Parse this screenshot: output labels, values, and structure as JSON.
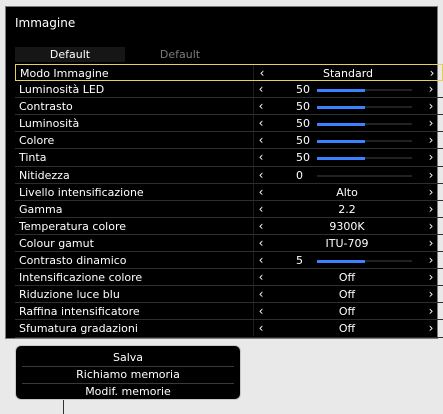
{
  "window": {
    "title": "Immagine"
  },
  "tabs": [
    {
      "label": "Default",
      "active": true
    },
    {
      "label": "Default",
      "active": false
    }
  ],
  "settings": [
    {
      "label": "Modo Immagine",
      "value": "Standard",
      "selected": true
    },
    {
      "label": "Luminosità LED",
      "value": "50",
      "slider": 0.5
    },
    {
      "label": "Contrasto",
      "value": "50",
      "slider": 0.5
    },
    {
      "label": "Luminosità",
      "value": "50",
      "slider": 0.5
    },
    {
      "label": "Colore",
      "value": "50",
      "slider": 0.5
    },
    {
      "label": "Tinta",
      "value": "50",
      "slider": 0.5
    },
    {
      "label": "Nitidezza",
      "value": "0",
      "slider": 0.0
    },
    {
      "label": "Livello intensificazione",
      "value": "Alto"
    },
    {
      "label": "Gamma",
      "value": "2.2"
    },
    {
      "label": "Temperatura colore",
      "value": "9300K"
    },
    {
      "label": "Colour gamut",
      "value": "ITU-709"
    },
    {
      "label": "Contrasto dinamico",
      "value": "5",
      "slider": 0.5
    },
    {
      "label": "Intensificazione colore",
      "value": "Off"
    },
    {
      "label": "Riduzione luce blu",
      "value": "Off"
    },
    {
      "label": "Raffina intensificatore",
      "value": "Off"
    },
    {
      "label": "Sfumatura gradazioni",
      "value": "Off"
    }
  ],
  "arrows": {
    "left": "‹",
    "right": "›"
  },
  "colors": {
    "slider_fill": "#3b82ff",
    "selection_border": "#e2d25b"
  },
  "menu": {
    "items": [
      {
        "label": "Salva"
      },
      {
        "label": "Richiamo memoria"
      },
      {
        "label": "Modif. memorie"
      }
    ]
  }
}
